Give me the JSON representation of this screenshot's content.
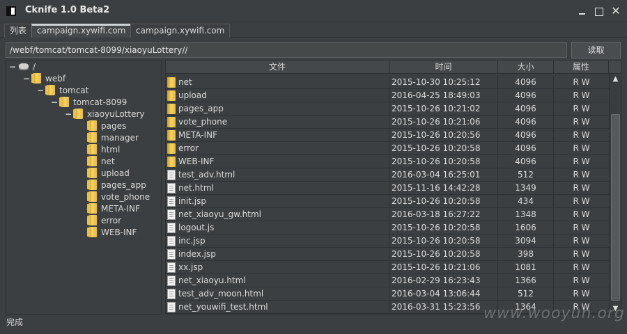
{
  "window": {
    "title": "Cknife 1.0 Beta2",
    "close_glyph": "✕"
  },
  "tabs": [
    {
      "label": "列表"
    },
    {
      "label": "campaign.xywifi.com"
    },
    {
      "label": "campaign.xywifi.com"
    }
  ],
  "path_bar": {
    "value": "/webf/tomcat/tomcat-8099/xiaoyuLottery//",
    "read_label": "读取"
  },
  "tree": {
    "toggle_glyph": "−",
    "nodes": [
      {
        "label": "/",
        "icon": "drive-icon",
        "depth": 0,
        "expanded": true
      },
      {
        "label": "webf",
        "icon": "folder-icon",
        "depth": 1,
        "expanded": true
      },
      {
        "label": "tomcat",
        "icon": "folder-icon",
        "depth": 2,
        "expanded": true
      },
      {
        "label": "tomcat-8099",
        "icon": "folder-icon",
        "depth": 3,
        "expanded": true
      },
      {
        "label": "xiaoyuLottery",
        "icon": "folder-icon",
        "depth": 4,
        "expanded": true
      },
      {
        "label": "pages",
        "icon": "folder-icon",
        "depth": 5
      },
      {
        "label": "manager",
        "icon": "folder-icon",
        "depth": 5
      },
      {
        "label": "html",
        "icon": "folder-icon",
        "depth": 5
      },
      {
        "label": "net",
        "icon": "folder-icon",
        "depth": 5
      },
      {
        "label": "upload",
        "icon": "folder-icon",
        "depth": 5
      },
      {
        "label": "pages_app",
        "icon": "folder-icon",
        "depth": 5
      },
      {
        "label": "vote_phone",
        "icon": "folder-icon",
        "depth": 5
      },
      {
        "label": "META-INF",
        "icon": "folder-icon",
        "depth": 5
      },
      {
        "label": "error",
        "icon": "folder-icon",
        "depth": 5
      },
      {
        "label": "WEB-INF",
        "icon": "folder-icon",
        "depth": 5
      }
    ]
  },
  "table": {
    "columns": [
      "文件",
      "时间",
      "大小",
      "属性"
    ],
    "rows": [
      {
        "type": "folder",
        "name": "net",
        "time": "2015-10-30 10:25:12",
        "size": "4096",
        "attr": "R W"
      },
      {
        "type": "folder",
        "name": "upload",
        "time": "2016-04-25 18:49:03",
        "size": "4096",
        "attr": "R W"
      },
      {
        "type": "folder",
        "name": "pages_app",
        "time": "2015-10-26 10:21:02",
        "size": "4096",
        "attr": "R W"
      },
      {
        "type": "folder",
        "name": "vote_phone",
        "time": "2015-10-26 10:21:06",
        "size": "4096",
        "attr": "R W"
      },
      {
        "type": "folder",
        "name": "META-INF",
        "time": "2015-10-26 10:20:56",
        "size": "4096",
        "attr": "R W"
      },
      {
        "type": "folder",
        "name": "error",
        "time": "2015-10-26 10:20:58",
        "size": "4096",
        "attr": "R W"
      },
      {
        "type": "folder",
        "name": "WEB-INF",
        "time": "2015-10-26 10:20:58",
        "size": "4096",
        "attr": "R W"
      },
      {
        "type": "file",
        "name": "test_adv.html",
        "time": "2016-03-04 16:25:01",
        "size": "512",
        "attr": "R W"
      },
      {
        "type": "file",
        "name": "net.html",
        "time": "2015-11-16 14:42:28",
        "size": "1349",
        "attr": "R W"
      },
      {
        "type": "file",
        "name": "init.jsp",
        "time": "2015-10-26 10:20:58",
        "size": "434",
        "attr": "R W"
      },
      {
        "type": "file",
        "name": "net_xiaoyu_gw.html",
        "time": "2016-03-18 16:27:22",
        "size": "1348",
        "attr": "R W"
      },
      {
        "type": "file",
        "name": "logout.js",
        "time": "2015-10-26 10:20:58",
        "size": "1606",
        "attr": "R W"
      },
      {
        "type": "file",
        "name": "inc.jsp",
        "time": "2015-10-26 10:20:58",
        "size": "3094",
        "attr": "R W"
      },
      {
        "type": "file",
        "name": "index.jsp",
        "time": "2015-10-26 10:20:58",
        "size": "398",
        "attr": "R W"
      },
      {
        "type": "file",
        "name": "xx.jsp",
        "time": "2015-10-26 10:21:06",
        "size": "1081",
        "attr": "R W"
      },
      {
        "type": "file",
        "name": "net_xiaoyu.html",
        "time": "2016-02-29 16:23:43",
        "size": "1366",
        "attr": "R W"
      },
      {
        "type": "file",
        "name": "test_adv_moon.html",
        "time": "2016-03-04 13:06:44",
        "size": "512",
        "attr": "R W"
      },
      {
        "type": "file",
        "name": "net_youwifi_test.html",
        "time": "2016-03-31 15:23:56",
        "size": "1364",
        "attr": "R W"
      }
    ]
  },
  "scrollbar": {
    "up_glyph": "▲",
    "down_glyph": "▼"
  },
  "status": {
    "text": "完成"
  },
  "watermark": {
    "text": "www.wooyun.org"
  }
}
